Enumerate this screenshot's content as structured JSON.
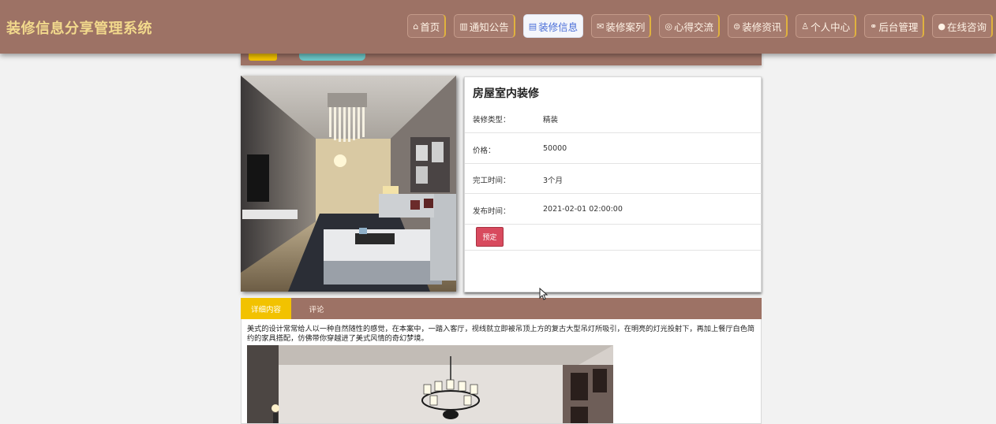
{
  "header": {
    "site_title": "装修信息分享管理系统",
    "nav": [
      {
        "icon": "home-icon",
        "glyph": "⌂",
        "label": "首页"
      },
      {
        "icon": "notice-icon",
        "glyph": "▥",
        "label": "通知公告"
      },
      {
        "icon": "list-icon",
        "glyph": "▤",
        "label": "装修信息",
        "active": true
      },
      {
        "icon": "case-icon",
        "glyph": "✉",
        "label": "装修案列"
      },
      {
        "icon": "chat-icon",
        "glyph": "◎",
        "label": "心得交流"
      },
      {
        "icon": "news-icon",
        "glyph": "⊜",
        "label": "装修资讯"
      },
      {
        "icon": "user-icon",
        "glyph": "♙",
        "label": "个人中心"
      },
      {
        "icon": "link-icon",
        "glyph": "⚭",
        "label": "后台管理"
      },
      {
        "icon": "consult-icon",
        "glyph": "●",
        "label": "在线咨询"
      }
    ]
  },
  "product": {
    "title": "房屋室内装修",
    "fields": [
      {
        "label": "装修类型：",
        "value": "精装"
      },
      {
        "label": "价格：",
        "value": "50000"
      },
      {
        "label": "完工时间：",
        "value": "3个月"
      },
      {
        "label": "发布时间：",
        "value": "2021-02-01 02:00:00"
      }
    ],
    "book_label": "预定"
  },
  "tabs": [
    {
      "label": "详细内容",
      "active": true
    },
    {
      "label": "评论"
    }
  ],
  "content": {
    "description": "美式的设计常常给人以一种自然随性的感觉，在本案中，一踏入客厅，视线就立即被吊顶上方的复古大型吊灯所吸引，在明亮的灯光投射下，再加上餐厅白色简约的家具搭配，仿佛带你穿越进了美式风情的奇幻梦境。"
  },
  "colors": {
    "header_bg": "#9d7265",
    "title_color": "#f2d98c",
    "active_nav_bg": "#f4f6fb",
    "book_button": "#d84a5e",
    "active_tab": "#f2c200"
  }
}
